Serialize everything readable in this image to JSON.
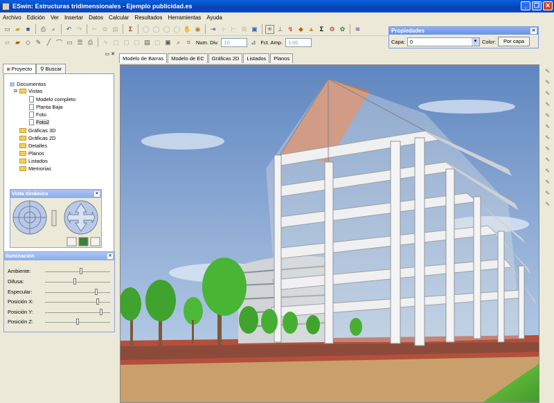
{
  "window": {
    "title": "ESwin: Estructuras tridimensionales - Ejemplo publicidad.es",
    "minimize": "_",
    "maximize": "❐",
    "close": "✕"
  },
  "menu": [
    "Archivo",
    "Edición",
    "Ver",
    "Insertar",
    "Datos",
    "Calcular",
    "Resultados",
    "Herramientas",
    "Ayuda"
  ],
  "toolbar": {
    "num_div_label": "Num. Div.",
    "num_div_value": "10",
    "fct_amp_label": "Fct. Amp.",
    "fct_amp_value": "1,00"
  },
  "propiedades": {
    "title": "Propiedades",
    "capa_label": "Capa:",
    "capa_value": "0",
    "color_label": "Color:",
    "porcapa_button": "Por capa"
  },
  "left_tabs": [
    "Proyecto",
    "Buscar"
  ],
  "tree": {
    "documentos": "Documentos",
    "vistas": "Vistas",
    "vistas_items": [
      "Modelo completo",
      "Planta Baja",
      "Foto",
      "Foto2"
    ],
    "folders": [
      "Gráficas 3D",
      "Gráficas 2D",
      "Detalles",
      "Planos",
      "Listados",
      "Memorias"
    ]
  },
  "vista_dinamica": {
    "title": "Vista dinámica"
  },
  "iluminacion": {
    "title": "Iluminación",
    "sliders": [
      {
        "label": "Ambiente:",
        "value": 0.55
      },
      {
        "label": "Difusa:",
        "value": 0.45
      },
      {
        "label": "Especular:",
        "value": 0.8
      },
      {
        "label": "Posición X:",
        "value": 0.82
      },
      {
        "label": "Posición Y:",
        "value": 0.88
      },
      {
        "label": "Posición Z:",
        "value": 0.5
      }
    ]
  },
  "view_tabs": [
    "Modelo de Barras",
    "Modelo de EC",
    "Gráficas 2D",
    "Listados",
    "Planos"
  ],
  "colors": {
    "titlebar": "#0842b5",
    "sky": "#8fb3dc",
    "grass": "#5fb94a",
    "brick": "#b54f3b"
  }
}
